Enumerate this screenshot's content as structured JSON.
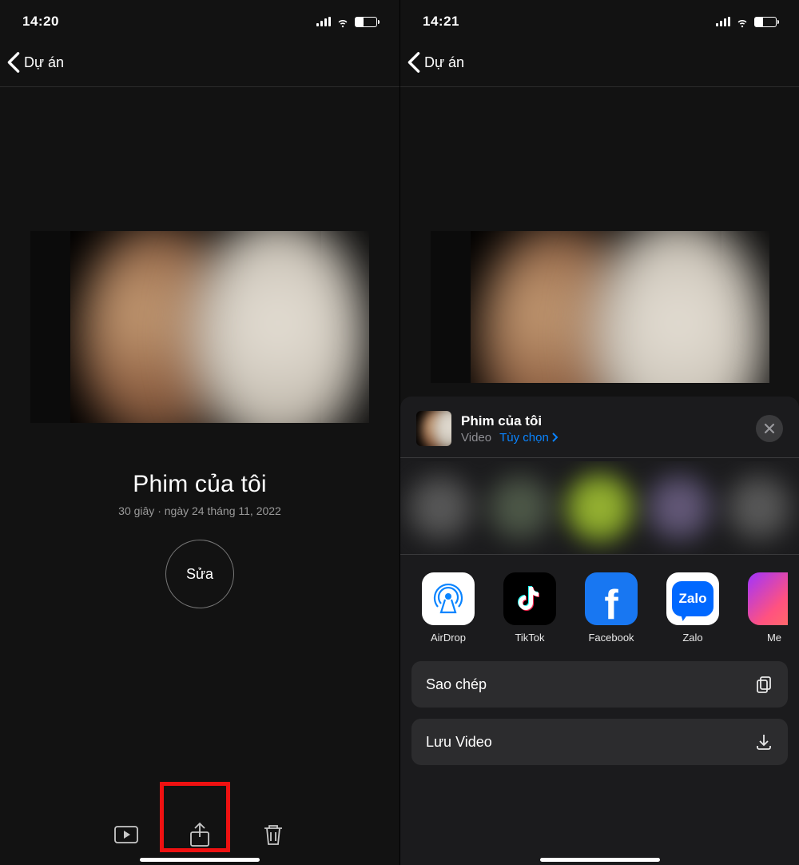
{
  "left": {
    "status_time": "14:20",
    "back_label": "Dự án",
    "project_title": "Phim của tôi",
    "project_meta": "30 giây · ngày 24 tháng 11, 2022",
    "edit_button": "Sửa"
  },
  "right": {
    "status_time": "14:21",
    "back_label": "Dự án",
    "sheet": {
      "title": "Phim của tôi",
      "subtitle_kind": "Video",
      "options_label": "Tùy chọn",
      "apps": [
        {
          "label": "AirDrop"
        },
        {
          "label": "TikTok"
        },
        {
          "label": "Facebook"
        },
        {
          "label": "Zalo"
        },
        {
          "label": "Me"
        }
      ],
      "actions": {
        "copy": "Sao chép",
        "save": "Lưu Video"
      }
    }
  }
}
